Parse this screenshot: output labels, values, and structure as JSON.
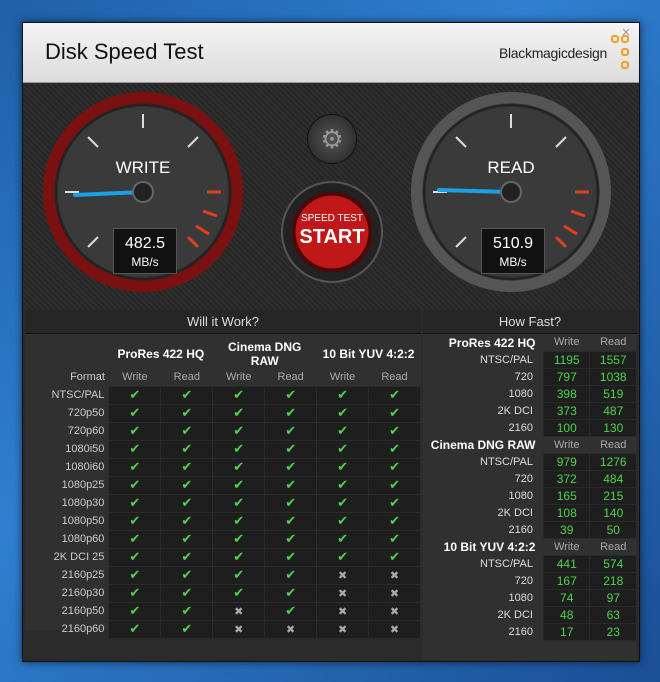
{
  "title": "Disk Speed Test",
  "brand": "Blackmagicdesign",
  "close": "×",
  "gauges": {
    "write": {
      "label": "WRITE",
      "value": "482.5",
      "unit": "MB/s"
    },
    "read": {
      "label": "READ",
      "value": "510.9",
      "unit": "MB/s"
    }
  },
  "start_button": {
    "line1": "SPEED TEST",
    "line2": "START"
  },
  "will_it_work": {
    "heading": "Will it Work?",
    "groups": [
      "ProRes 422 HQ",
      "Cinema DNG RAW",
      "10 Bit YUV 4:2:2"
    ],
    "format_label": "Format",
    "write_label": "Write",
    "read_label": "Read",
    "rows": [
      {
        "f": "NTSC/PAL",
        "v": [
          1,
          1,
          1,
          1,
          1,
          1
        ]
      },
      {
        "f": "720p50",
        "v": [
          1,
          1,
          1,
          1,
          1,
          1
        ]
      },
      {
        "f": "720p60",
        "v": [
          1,
          1,
          1,
          1,
          1,
          1
        ]
      },
      {
        "f": "1080i50",
        "v": [
          1,
          1,
          1,
          1,
          1,
          1
        ]
      },
      {
        "f": "1080i60",
        "v": [
          1,
          1,
          1,
          1,
          1,
          1
        ]
      },
      {
        "f": "1080p25",
        "v": [
          1,
          1,
          1,
          1,
          1,
          1
        ]
      },
      {
        "f": "1080p30",
        "v": [
          1,
          1,
          1,
          1,
          1,
          1
        ]
      },
      {
        "f": "1080p50",
        "v": [
          1,
          1,
          1,
          1,
          1,
          1
        ]
      },
      {
        "f": "1080p60",
        "v": [
          1,
          1,
          1,
          1,
          1,
          1
        ]
      },
      {
        "f": "2K DCI 25",
        "v": [
          1,
          1,
          1,
          1,
          1,
          1
        ]
      },
      {
        "f": "2160p25",
        "v": [
          1,
          1,
          1,
          1,
          0,
          0
        ]
      },
      {
        "f": "2160p30",
        "v": [
          1,
          1,
          1,
          1,
          0,
          0
        ]
      },
      {
        "f": "2160p50",
        "v": [
          1,
          1,
          0,
          1,
          0,
          0
        ]
      },
      {
        "f": "2160p60",
        "v": [
          1,
          1,
          0,
          0,
          0,
          0
        ]
      }
    ]
  },
  "how_fast": {
    "heading": "How Fast?",
    "write_label": "Write",
    "read_label": "Read",
    "groups": [
      {
        "name": "ProRes 422 HQ",
        "rows": [
          {
            "f": "NTSC/PAL",
            "w": "1195",
            "r": "1557"
          },
          {
            "f": "720",
            "w": "797",
            "r": "1038"
          },
          {
            "f": "1080",
            "w": "398",
            "r": "519"
          },
          {
            "f": "2K DCI",
            "w": "373",
            "r": "487"
          },
          {
            "f": "2160",
            "w": "100",
            "r": "130"
          }
        ]
      },
      {
        "name": "Cinema DNG RAW",
        "rows": [
          {
            "f": "NTSC/PAL",
            "w": "979",
            "r": "1276"
          },
          {
            "f": "720",
            "w": "372",
            "r": "484"
          },
          {
            "f": "1080",
            "w": "165",
            "r": "215"
          },
          {
            "f": "2K DCI",
            "w": "108",
            "r": "140"
          },
          {
            "f": "2160",
            "w": "39",
            "r": "50"
          }
        ]
      },
      {
        "name": "10 Bit YUV 4:2:2",
        "rows": [
          {
            "f": "NTSC/PAL",
            "w": "441",
            "r": "574"
          },
          {
            "f": "720",
            "w": "167",
            "r": "218"
          },
          {
            "f": "1080",
            "w": "74",
            "r": "97"
          },
          {
            "f": "2K DCI",
            "w": "48",
            "r": "63"
          },
          {
            "f": "2160",
            "w": "17",
            "r": "23"
          }
        ]
      }
    ]
  },
  "colors": {
    "check": "#4fd44f",
    "accent_red": "#c02020",
    "needle": "#1aa0e8"
  }
}
